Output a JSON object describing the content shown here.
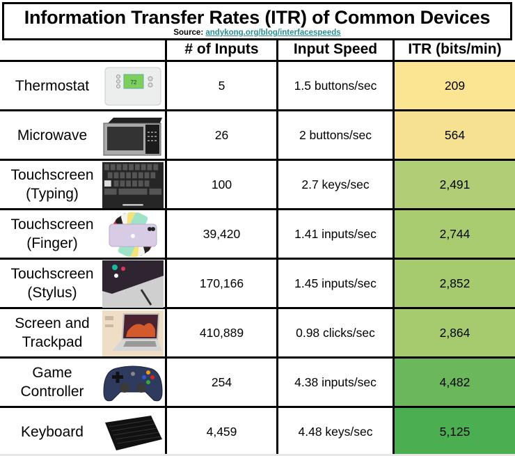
{
  "title": "Information Transfer Rates (ITR) of Common Devices",
  "source_label": "Source:",
  "source_link": "andykong.org/blog/interfacespeeds",
  "headers": [
    "",
    "# of Inputs",
    "Input Speed",
    "ITR (bits/min)"
  ],
  "rows": [
    {
      "device": "Thermostat",
      "icon": "thermostat-icon",
      "inputs": "5",
      "speed": "1.5 buttons/sec",
      "itr": "209",
      "itr_color": "#FCE592"
    },
    {
      "device": "Microwave",
      "icon": "microwave-icon",
      "inputs": "26",
      "speed": "2 buttons/sec",
      "itr": "564",
      "itr_color": "#F6E192"
    },
    {
      "device": "Touchscreen (Typing)",
      "icon": "phone-keyboard-icon",
      "inputs": "100",
      "speed": "2.7 keys/sec",
      "itr": "2,491",
      "itr_color": "#B1CE76"
    },
    {
      "device": "Touchscreen (Finger)",
      "icon": "smartphone-icon",
      "inputs": "39,420",
      "speed": "1.41 inputs/sec",
      "itr": "2,744",
      "itr_color": "#A8CC6F"
    },
    {
      "device": "Touchscreen (Stylus)",
      "icon": "tablet-stylus-icon",
      "inputs": "170,166",
      "speed": "1.45 inputs/sec",
      "itr": "2,852",
      "itr_color": "#A6CB6E"
    },
    {
      "device": "Screen and Trackpad",
      "icon": "laptop-icon",
      "inputs": "410,889",
      "speed": "0.98 clicks/sec",
      "itr": "2,864",
      "itr_color": "#A6CB6E"
    },
    {
      "device": "Game Controller",
      "icon": "gamepad-icon",
      "inputs": "254",
      "speed": "4.38 inputs/sec",
      "itr": "4,482",
      "itr_color": "#6AB85B"
    },
    {
      "device": "Keyboard",
      "icon": "keyboard-icon",
      "inputs": "4,459",
      "speed": "4.48 keys/sec",
      "itr": "5,125",
      "itr_color": "#4BAE50"
    }
  ]
}
